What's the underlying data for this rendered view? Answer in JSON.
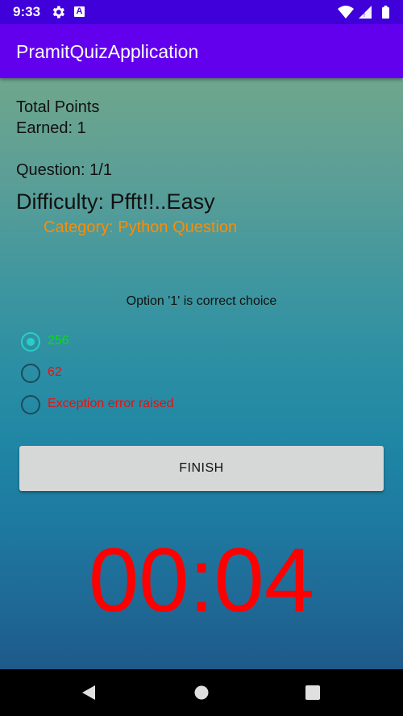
{
  "status_bar": {
    "time": "9:33",
    "icons": [
      "gear-icon",
      "a-icon",
      "wifi-icon",
      "signal-icon",
      "battery-icon"
    ],
    "a_glyph": "A"
  },
  "app_bar": {
    "title": "PramitQuizApplication",
    "color": "#6200ee"
  },
  "quiz": {
    "points_text": "Total Points Earned: 1",
    "question_text": "Question: 1/1",
    "difficulty_text": "Difficulty: Pfft!!..Easy",
    "category_text": "Category: Python Question",
    "feedback_text": "Option '1' is correct choice",
    "options": [
      {
        "label": "256",
        "color": "#00e600",
        "selected": true
      },
      {
        "label": "62",
        "color": "#e81010",
        "selected": false
      },
      {
        "label": "Exception error raised",
        "color": "#e81010",
        "selected": false
      }
    ],
    "finish_label": "FINISH",
    "timer": "00:04",
    "timer_color": "#ff0000",
    "category_color": "#ff8c00"
  },
  "nav_bar": {
    "icons": [
      "back-icon",
      "home-icon",
      "recents-icon"
    ]
  }
}
